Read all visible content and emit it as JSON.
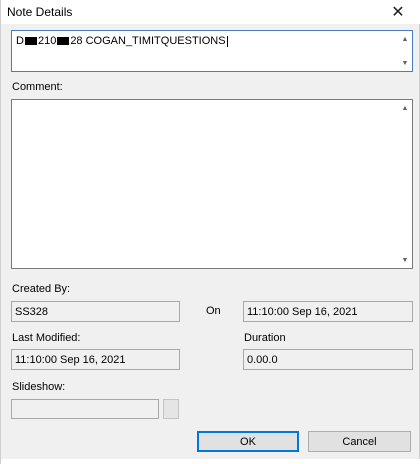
{
  "window": {
    "title": "Note Details",
    "close_glyph": "✕"
  },
  "name_field": {
    "prefix": "D",
    "middle": "210",
    "suffix": "28 COGAN_TIMITQUESTIONS"
  },
  "comment": {
    "label": "Comment:",
    "value": ""
  },
  "created_by": {
    "label": "Created By:",
    "value": "SS328"
  },
  "on": {
    "label": "On",
    "value": "11:10:00 Sep 16, 2021"
  },
  "last_modified": {
    "label": "Last Modified:",
    "value": "11:10:00 Sep 16, 2021"
  },
  "duration": {
    "label": "Duration",
    "value": "0.00.0"
  },
  "slideshow": {
    "label": "Slideshow:",
    "value": ""
  },
  "buttons": {
    "ok": "OK",
    "cancel": "Cancel"
  },
  "scroll": {
    "up": "▲",
    "down": "▼"
  },
  "colors": {
    "accent": "#0078d7",
    "dialog_bg": "#f0f0f0"
  }
}
